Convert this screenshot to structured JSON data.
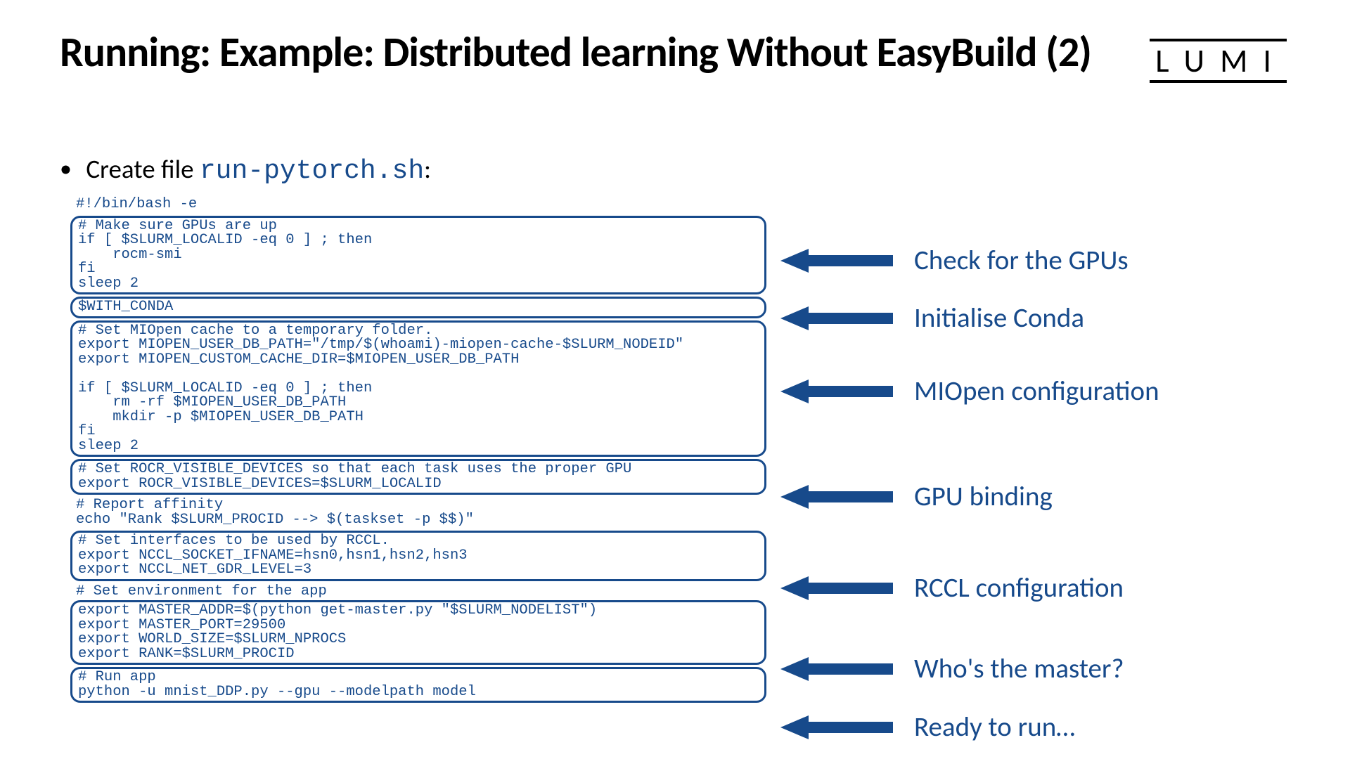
{
  "title": "Running: Example: Distributed learning Without EasyBuild (2)",
  "logo": "LUMI",
  "bullet_prefix": "Create file ",
  "bullet_filename": "run-pytorch.sh",
  "bullet_suffix": ":",
  "code": {
    "shebang": "#!/bin/bash -e",
    "block1": "# Make sure GPUs are up\nif [ $SLURM_LOCALID -eq 0 ] ; then\n    rocm-smi\nfi\nsleep 2",
    "block2": "$WITH_CONDA",
    "block3": "# Set MIOpen cache to a temporary folder.\nexport MIOPEN_USER_DB_PATH=\"/tmp/$(whoami)-miopen-cache-$SLURM_NODEID\"\nexport MIOPEN_CUSTOM_CACHE_DIR=$MIOPEN_USER_DB_PATH\n\nif [ $SLURM_LOCALID -eq 0 ] ; then\n    rm -rf $MIOPEN_USER_DB_PATH\n    mkdir -p $MIOPEN_USER_DB_PATH\nfi\nsleep 2",
    "block4": "# Set ROCR_VISIBLE_DEVICES so that each task uses the proper GPU\nexport ROCR_VISIBLE_DEVICES=$SLURM_LOCALID",
    "affinity": "# Report affinity\necho \"Rank $SLURM_PROCID --> $(taskset -p $$)\"",
    "block5": "# Set interfaces to be used by RCCL.\nexport NCCL_SOCKET_IFNAME=hsn0,hsn1,hsn2,hsn3\nexport NCCL_NET_GDR_LEVEL=3",
    "env_header": "# Set environment for the app",
    "block6": "export MASTER_ADDR=$(python get-master.py \"$SLURM_NODELIST\")\nexport MASTER_PORT=29500\nexport WORLD_SIZE=$SLURM_NPROCS\nexport RANK=$SLURM_PROCID",
    "block7": "# Run app\npython -u mnist_DDP.py --gpu --modelpath model"
  },
  "labels": {
    "l1": "Check for the GPUs",
    "l2": "Initialise Conda",
    "l3": "MIOpen configuration",
    "l4": "GPU binding",
    "l5": "RCCL configuration",
    "l6": "Who's the master?",
    "l7": "Ready to run…"
  }
}
